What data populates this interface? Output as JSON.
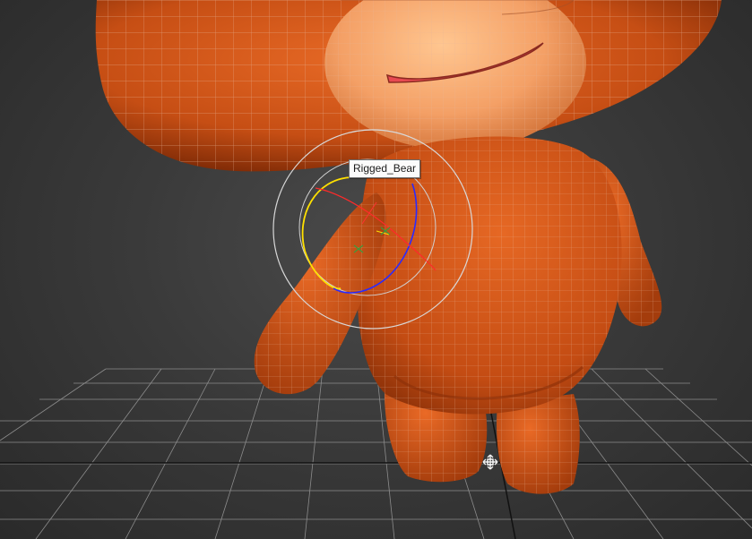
{
  "viewport": {
    "object_tooltip": "Rigged_Bear"
  },
  "colors": {
    "background": "#3a3a3a",
    "grid_line": "#8c8c8c",
    "grid_axis": "#111111",
    "body_light": "#e2621f",
    "body_mid": "#c64e14",
    "body_dark": "#8a2e08",
    "muzzle": "#f4a66a",
    "mouth": "#e84a52",
    "wire": "#d7a38a",
    "gizmo_outer": "#d8d8d8",
    "gizmo_x": "#ff2a2a",
    "gizmo_y": "#ffe000",
    "gizmo_z": "#2a2aff",
    "gizmo_center": "#3c9c3c"
  },
  "icons": [
    "pivot-icon"
  ]
}
